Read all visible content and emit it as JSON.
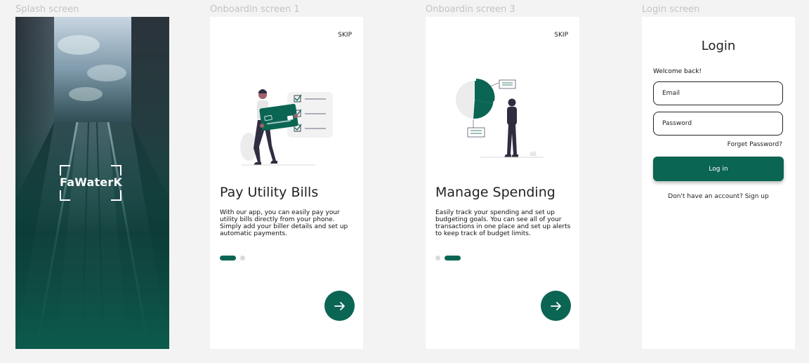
{
  "frames": {
    "splash_label": "Splash screen",
    "onboarding1_label": "Onboardin screen 1",
    "onboarding3_label": "Onboardin screen 3",
    "login_label": "Login screen"
  },
  "splash": {
    "logo_text": "FaWaterK",
    "gradient_color": "#0b5a4c"
  },
  "onboarding1": {
    "skip_label": "SKIP",
    "title": "Pay Utility Bills",
    "description": "With our app, you can easily pay your utility bills directly from your phone. Simply add your biller details and set up automatic payments.",
    "active_page": 1,
    "page_count": 2,
    "next_icon": "arrow-right-icon"
  },
  "onboarding3": {
    "skip_label": "SKIP",
    "title": "Manage Spending",
    "description": "Easily track your spending and set up budgeting goals. You can see all of your transactions in one place and set up alerts to keep track of budget limits.",
    "active_page": 2,
    "page_count": 2,
    "next_icon": "arrow-right-icon"
  },
  "login": {
    "title": "Login",
    "welcome": "Welcome back!",
    "email_placeholder": "Email",
    "password_placeholder": "Password",
    "forgot_label": "Forget Password?",
    "login_button": "Log in",
    "signup_text": "Don't have an account? Sign up"
  },
  "colors": {
    "accent": "#0b6553",
    "page_bg": "#f3f3f3",
    "label_gray": "#c4c4c4"
  }
}
